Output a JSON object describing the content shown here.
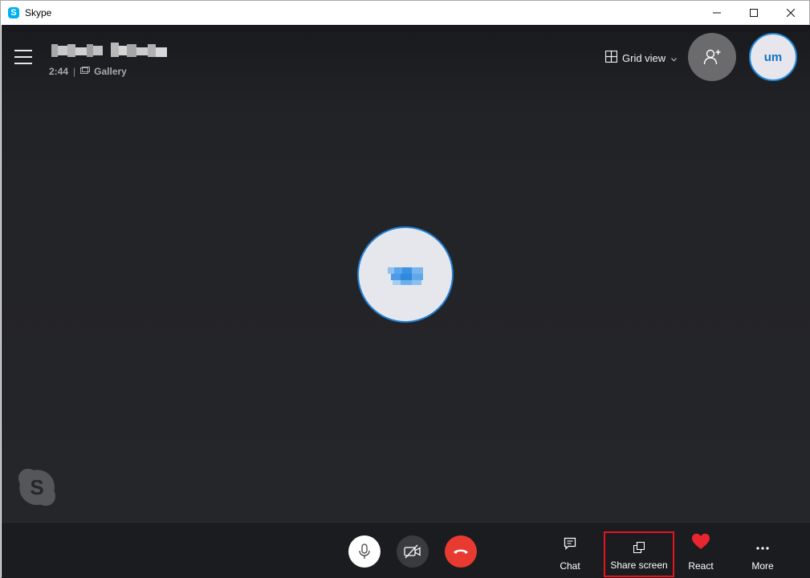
{
  "window": {
    "title": "Skype",
    "app_icon_letter": "S",
    "controls": [
      "minimize",
      "maximize",
      "close"
    ]
  },
  "call": {
    "duration": "2:44",
    "separator": "|",
    "view_mode": "Gallery",
    "caller_name_visible": false
  },
  "header": {
    "grid_view_label": "Grid view",
    "self_initials": "um"
  },
  "controls": {
    "chat_label": "Chat",
    "share_label": "Share screen",
    "react_label": "React",
    "more_label": "More"
  },
  "colors": {
    "stage_bg": "#25262a",
    "end_call": "#e93a31",
    "accent_blue": "#1e7fd6",
    "highlight_box": "#e3141f",
    "react_heart": "#e8262f"
  },
  "icons": [
    "hamburger-icon",
    "gallery-icon",
    "grid-view-icon",
    "chevron-down-icon",
    "add-person-icon",
    "microphone-icon",
    "video-off-icon",
    "end-call-icon",
    "chat-icon",
    "share-screen-icon",
    "heart-icon",
    "more-icon",
    "skype-logo-icon"
  ]
}
